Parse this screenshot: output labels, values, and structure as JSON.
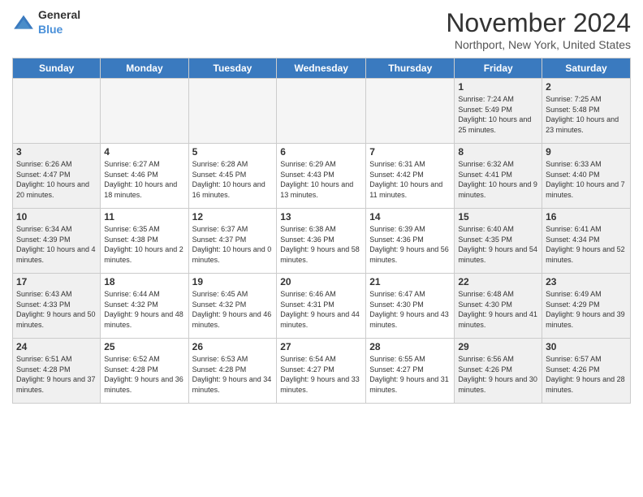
{
  "logo": {
    "general": "General",
    "blue": "Blue"
  },
  "header": {
    "month": "November 2024",
    "location": "Northport, New York, United States"
  },
  "days_of_week": [
    "Sunday",
    "Monday",
    "Tuesday",
    "Wednesday",
    "Thursday",
    "Friday",
    "Saturday"
  ],
  "weeks": [
    [
      {
        "day": "",
        "info": "",
        "empty": true
      },
      {
        "day": "",
        "info": "",
        "empty": true
      },
      {
        "day": "",
        "info": "",
        "empty": true
      },
      {
        "day": "",
        "info": "",
        "empty": true
      },
      {
        "day": "",
        "info": "",
        "empty": true
      },
      {
        "day": "1",
        "info": "Sunrise: 7:24 AM\nSunset: 5:49 PM\nDaylight: 10 hours and 25 minutes.",
        "weekend": true
      },
      {
        "day": "2",
        "info": "Sunrise: 7:25 AM\nSunset: 5:48 PM\nDaylight: 10 hours and 23 minutes.",
        "weekend": true
      }
    ],
    [
      {
        "day": "3",
        "info": "Sunrise: 6:26 AM\nSunset: 4:47 PM\nDaylight: 10 hours and 20 minutes.",
        "weekend": true
      },
      {
        "day": "4",
        "info": "Sunrise: 6:27 AM\nSunset: 4:46 PM\nDaylight: 10 hours and 18 minutes."
      },
      {
        "day": "5",
        "info": "Sunrise: 6:28 AM\nSunset: 4:45 PM\nDaylight: 10 hours and 16 minutes."
      },
      {
        "day": "6",
        "info": "Sunrise: 6:29 AM\nSunset: 4:43 PM\nDaylight: 10 hours and 13 minutes."
      },
      {
        "day": "7",
        "info": "Sunrise: 6:31 AM\nSunset: 4:42 PM\nDaylight: 10 hours and 11 minutes."
      },
      {
        "day": "8",
        "info": "Sunrise: 6:32 AM\nSunset: 4:41 PM\nDaylight: 10 hours and 9 minutes.",
        "weekend": true
      },
      {
        "day": "9",
        "info": "Sunrise: 6:33 AM\nSunset: 4:40 PM\nDaylight: 10 hours and 7 minutes.",
        "weekend": true
      }
    ],
    [
      {
        "day": "10",
        "info": "Sunrise: 6:34 AM\nSunset: 4:39 PM\nDaylight: 10 hours and 4 minutes.",
        "weekend": true
      },
      {
        "day": "11",
        "info": "Sunrise: 6:35 AM\nSunset: 4:38 PM\nDaylight: 10 hours and 2 minutes."
      },
      {
        "day": "12",
        "info": "Sunrise: 6:37 AM\nSunset: 4:37 PM\nDaylight: 10 hours and 0 minutes."
      },
      {
        "day": "13",
        "info": "Sunrise: 6:38 AM\nSunset: 4:36 PM\nDaylight: 9 hours and 58 minutes."
      },
      {
        "day": "14",
        "info": "Sunrise: 6:39 AM\nSunset: 4:36 PM\nDaylight: 9 hours and 56 minutes."
      },
      {
        "day": "15",
        "info": "Sunrise: 6:40 AM\nSunset: 4:35 PM\nDaylight: 9 hours and 54 minutes.",
        "weekend": true
      },
      {
        "day": "16",
        "info": "Sunrise: 6:41 AM\nSunset: 4:34 PM\nDaylight: 9 hours and 52 minutes.",
        "weekend": true
      }
    ],
    [
      {
        "day": "17",
        "info": "Sunrise: 6:43 AM\nSunset: 4:33 PM\nDaylight: 9 hours and 50 minutes.",
        "weekend": true
      },
      {
        "day": "18",
        "info": "Sunrise: 6:44 AM\nSunset: 4:32 PM\nDaylight: 9 hours and 48 minutes."
      },
      {
        "day": "19",
        "info": "Sunrise: 6:45 AM\nSunset: 4:32 PM\nDaylight: 9 hours and 46 minutes."
      },
      {
        "day": "20",
        "info": "Sunrise: 6:46 AM\nSunset: 4:31 PM\nDaylight: 9 hours and 44 minutes."
      },
      {
        "day": "21",
        "info": "Sunrise: 6:47 AM\nSunset: 4:30 PM\nDaylight: 9 hours and 43 minutes."
      },
      {
        "day": "22",
        "info": "Sunrise: 6:48 AM\nSunset: 4:30 PM\nDaylight: 9 hours and 41 minutes.",
        "weekend": true
      },
      {
        "day": "23",
        "info": "Sunrise: 6:49 AM\nSunset: 4:29 PM\nDaylight: 9 hours and 39 minutes.",
        "weekend": true
      }
    ],
    [
      {
        "day": "24",
        "info": "Sunrise: 6:51 AM\nSunset: 4:28 PM\nDaylight: 9 hours and 37 minutes.",
        "weekend": true
      },
      {
        "day": "25",
        "info": "Sunrise: 6:52 AM\nSunset: 4:28 PM\nDaylight: 9 hours and 36 minutes."
      },
      {
        "day": "26",
        "info": "Sunrise: 6:53 AM\nSunset: 4:28 PM\nDaylight: 9 hours and 34 minutes."
      },
      {
        "day": "27",
        "info": "Sunrise: 6:54 AM\nSunset: 4:27 PM\nDaylight: 9 hours and 33 minutes."
      },
      {
        "day": "28",
        "info": "Sunrise: 6:55 AM\nSunset: 4:27 PM\nDaylight: 9 hours and 31 minutes."
      },
      {
        "day": "29",
        "info": "Sunrise: 6:56 AM\nSunset: 4:26 PM\nDaylight: 9 hours and 30 minutes.",
        "weekend": true
      },
      {
        "day": "30",
        "info": "Sunrise: 6:57 AM\nSunset: 4:26 PM\nDaylight: 9 hours and 28 minutes.",
        "weekend": true
      }
    ]
  ]
}
